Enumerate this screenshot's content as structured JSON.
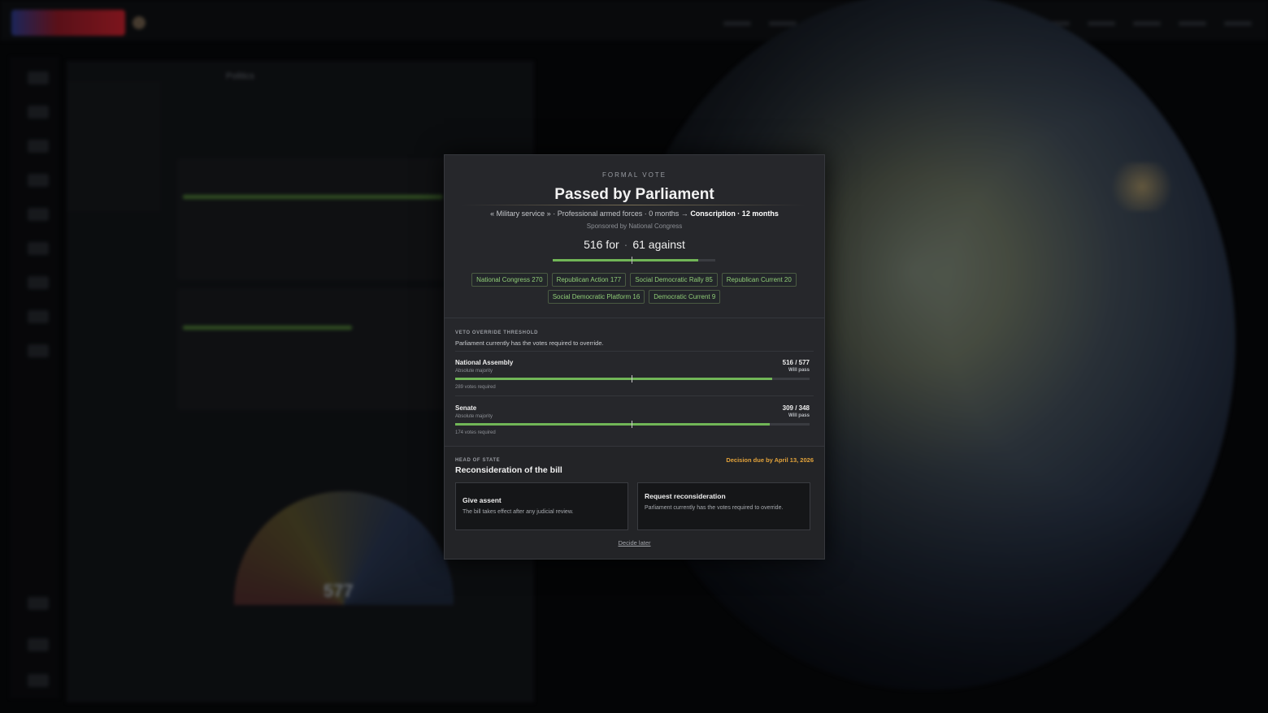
{
  "modal": {
    "eyebrow": "FORMAL VOTE",
    "title": "Passed by Parliament",
    "change": {
      "bill": "« Military service »",
      "from": "Professional armed forces · 0 months",
      "arrow": "→",
      "to": "Conscription · 12 months"
    },
    "sponsor": "Sponsored by National Congress",
    "tally": {
      "for_label": "516 for",
      "against_label": "61 against",
      "for": 516,
      "against": 61
    },
    "party_chips": [
      "National Congress 270",
      "Republican Action 177",
      "Social Democratic Rally 85",
      "Republican Current 20",
      "Social Democratic Platform 16",
      "Democratic Current 9"
    ],
    "veto": {
      "label": "VETO OVERRIDE THRESHOLD",
      "text": "Parliament currently has the votes required to override.",
      "chambers": [
        {
          "name": "National Assembly",
          "majority": "Absolute majority",
          "count": "516 / 577",
          "status": "Will pass",
          "required": "289 votes required",
          "fraction": 0.894
        },
        {
          "name": "Senate",
          "majority": "Absolute majority",
          "count": "309 / 348",
          "status": "Will pass",
          "required": "174 votes required",
          "fraction": 0.888
        }
      ]
    },
    "head_of_state": {
      "label": "HEAD OF STATE",
      "due": "Decision due by April 13, 2026",
      "decision_title": "Reconsideration of the bill",
      "options": [
        {
          "title": "Give assent",
          "desc": "The bill takes effect after any judicial review."
        },
        {
          "title": "Request reconsideration",
          "desc": "Parliament currently has the votes required to override."
        }
      ],
      "later": "Decide later"
    }
  },
  "background": {
    "panel_title": "Politics",
    "seat_total": "577"
  },
  "colors": {
    "accent_green": "#71b657",
    "due_orange": "#e3a33b",
    "chip_text": "#8fcc76"
  }
}
